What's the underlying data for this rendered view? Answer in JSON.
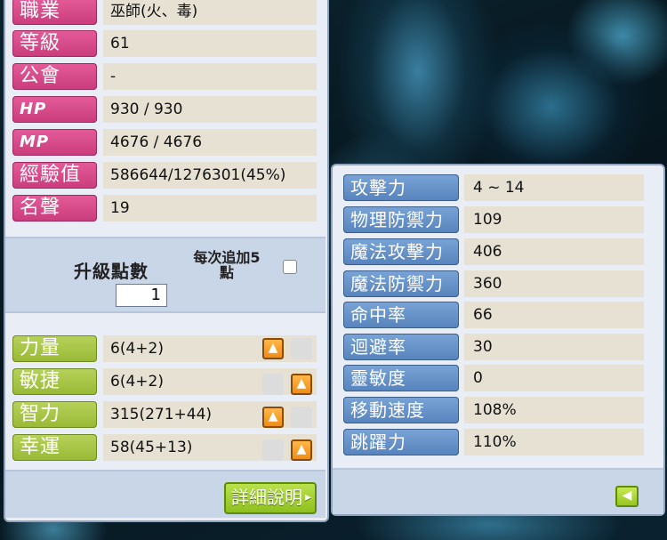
{
  "info": [
    {
      "label": "職業",
      "value": "巫師(火、毒)"
    },
    {
      "label": "等級",
      "value": "61"
    },
    {
      "label": "公會",
      "value": "-"
    },
    {
      "label": "HP",
      "value": "930 / 930"
    },
    {
      "label": "MP",
      "value": "4676 / 4676"
    },
    {
      "label": "經驗值",
      "value": "586644/1276301(45%)"
    },
    {
      "label": "名聲",
      "value": "19"
    }
  ],
  "ap": {
    "label": "升級點數",
    "value": "1",
    "each_label_line1": "每次追加5",
    "each_label_line2": "點"
  },
  "stats": [
    {
      "label": "力量",
      "value": "6(4+2)"
    },
    {
      "label": "敏捷",
      "value": "6(4+2)"
    },
    {
      "label": "智力",
      "value": "315(271+44)"
    },
    {
      "label": "幸運",
      "value": "58(45+13)"
    }
  ],
  "detail_button": "詳細說明",
  "detail_stats": [
    {
      "label": "攻擊力",
      "value": "4 ~ 14"
    },
    {
      "label": "物理防禦力",
      "value": "109"
    },
    {
      "label": "魔法攻擊力",
      "value": "406"
    },
    {
      "label": "魔法防禦力",
      "value": "360"
    },
    {
      "label": "命中率",
      "value": "66"
    },
    {
      "label": "迴避率",
      "value": "30"
    },
    {
      "label": "靈敏度",
      "value": "0"
    },
    {
      "label": "移動速度",
      "value": "108%"
    },
    {
      "label": "跳躍力",
      "value": "110%"
    }
  ],
  "colors": {
    "pink": "#d9468a",
    "green": "#a8c744",
    "blue": "#6690c8",
    "orange": "#f39a22"
  }
}
